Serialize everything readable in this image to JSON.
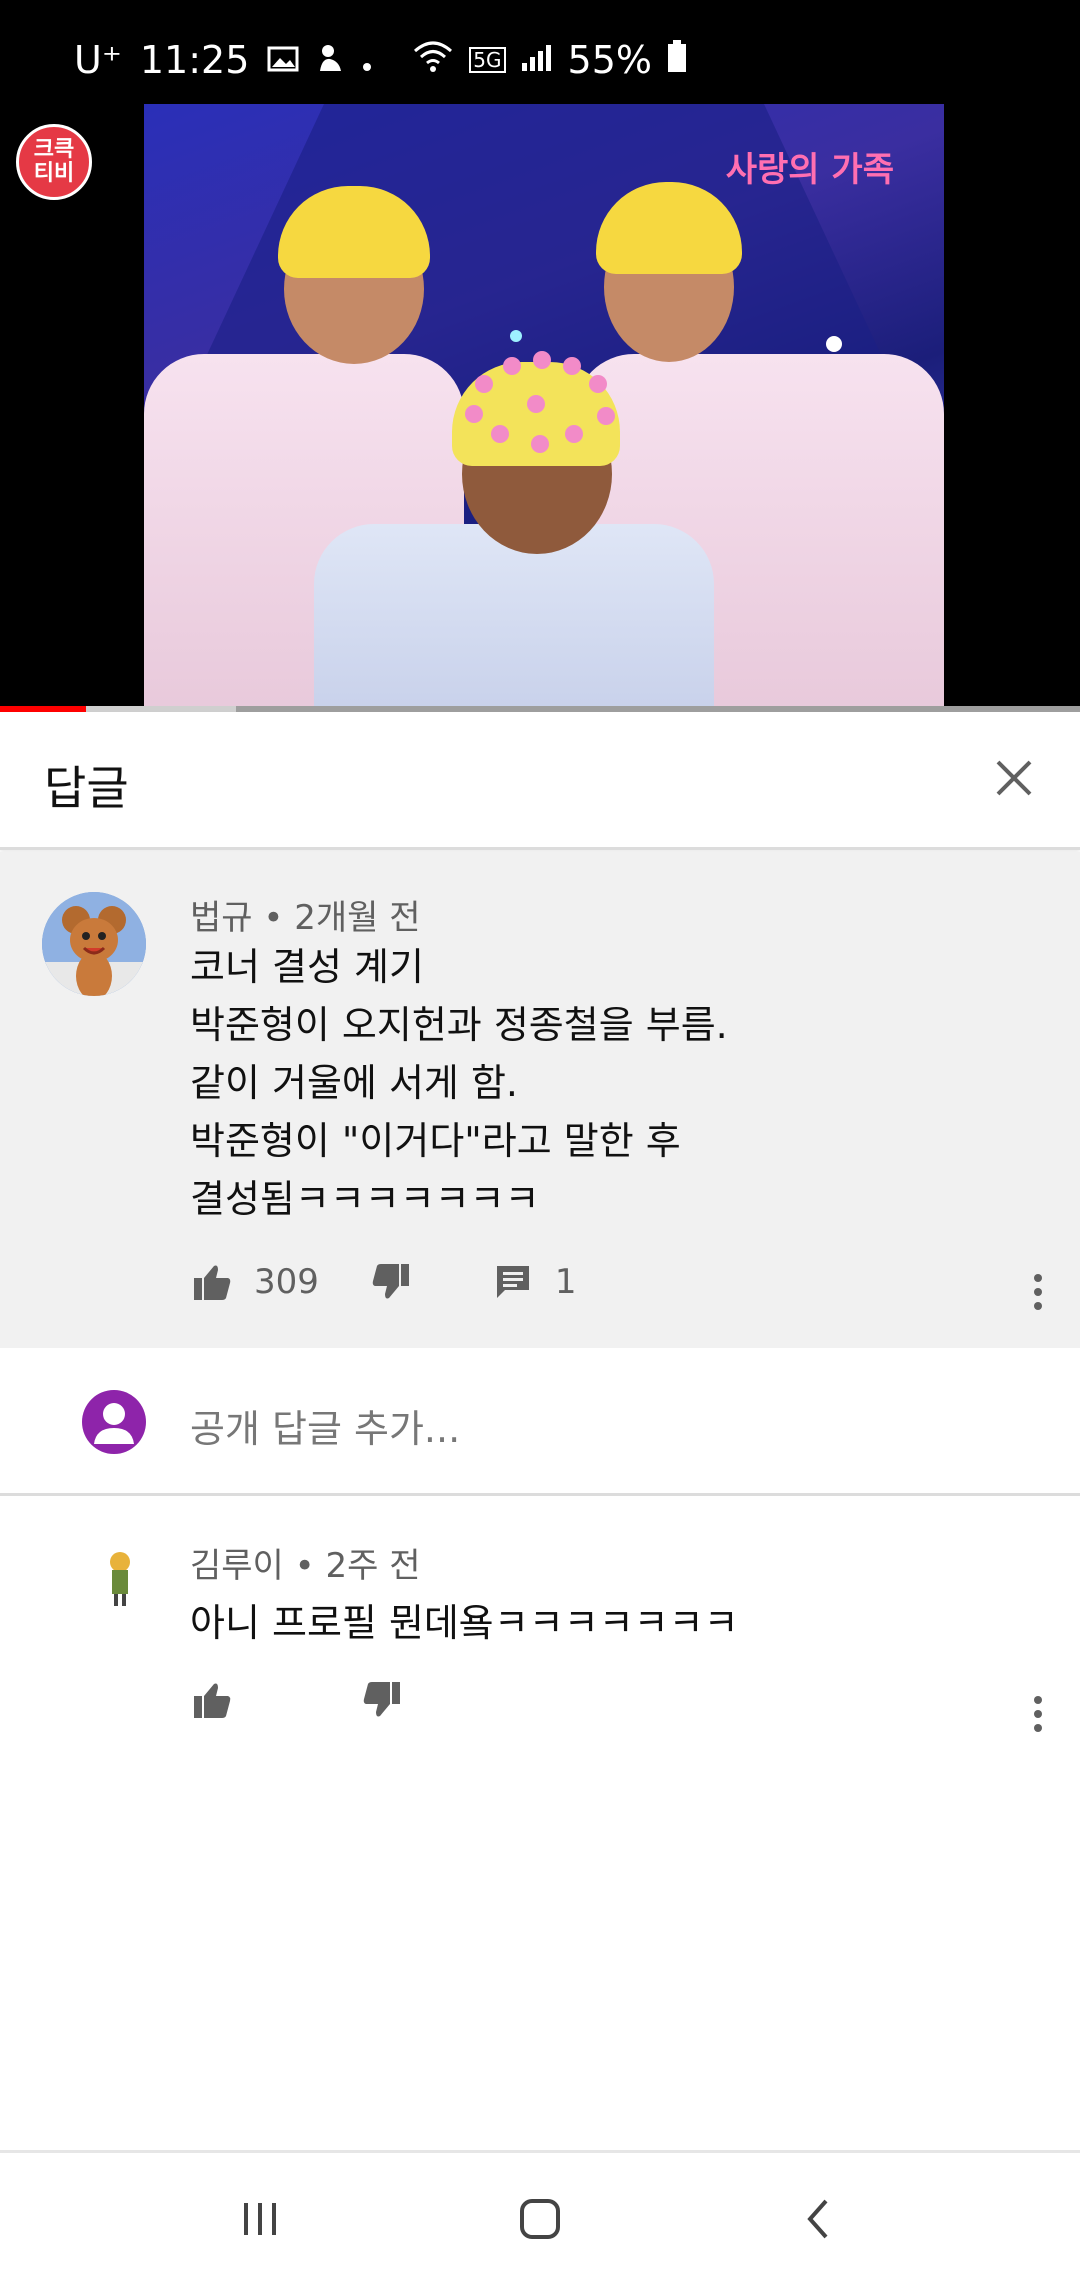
{
  "status_bar": {
    "carrier": "U⁺",
    "time": "11:25",
    "network": "5G",
    "battery": "55%"
  },
  "video": {
    "channel_badge": [
      "크큭",
      "티비"
    ],
    "show_logo": "사랑의 가족",
    "progress_fraction": 0.08
  },
  "reply_panel": {
    "title": "답글"
  },
  "main_comment": {
    "author": "법규",
    "time": "2개월 전",
    "body": "코너 결성 계기\n박준형이 오지헌과 정종철을 부름.\n같이 거울에 서게 함.\n박준형이 \"이거다\"라고 말한 후\n결성됨ㅋㅋㅋㅋㅋㅋㅋ",
    "likes": "309",
    "replies": "1"
  },
  "add_reply": {
    "placeholder": "공개 답글 추가..."
  },
  "replies": [
    {
      "author": "김루이",
      "time": "2주 전",
      "body": "아니 프로필 뭔데욬ㅋㅋㅋㅋㅋㅋㅋ"
    }
  ],
  "separator": "•",
  "colors": {
    "accent_red": "#ff0000",
    "comment_bg": "#f1f1f1",
    "user_avatar": "#8e24aa"
  }
}
